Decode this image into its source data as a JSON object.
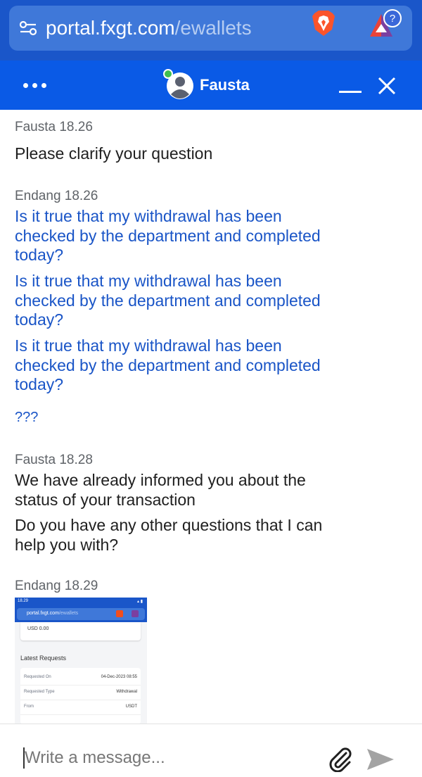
{
  "browser": {
    "url_host": "portal.fxgt.com",
    "url_path": "/ewallets",
    "rewards_badge": "?"
  },
  "chat": {
    "agent_name": "Fausta",
    "messages": [
      {
        "meta": "Fausta 18.26",
        "texts": [
          "Please clarify your question"
        ]
      },
      {
        "meta": "Endang 18.26",
        "texts": [
          "Is it true that my withdrawal has been checked by the department and completed today?",
          "Is it true that my withdrawal has been checked by the department and completed today?",
          "Is it true that my withdrawal has been checked by the department and completed today?",
          "???"
        ]
      },
      {
        "meta": "Fausta 18.28",
        "texts": [
          "We have already informed you about the status of your transaction",
          "Do you have any other questions that I can help you with?"
        ]
      },
      {
        "meta": "Endang 18.29"
      }
    ]
  },
  "attachment": {
    "status_time": "18.29",
    "url_host": "portal.fxgt.com",
    "url_path": "/ewallets",
    "card_value": "USD 0.00",
    "heading": "Latest Requests",
    "rows": [
      {
        "key": "Requested On",
        "value": "04-Dec-2023 08:55"
      },
      {
        "key": "Requested Type",
        "value": "Withdrawal"
      },
      {
        "key": "From",
        "value": "USDT"
      }
    ]
  },
  "composer": {
    "placeholder": "Write a message..."
  },
  "colors": {
    "header_blue": "#0a5ae6",
    "browser_blue": "#1a56c9",
    "customer_text": "#1a55c7"
  }
}
